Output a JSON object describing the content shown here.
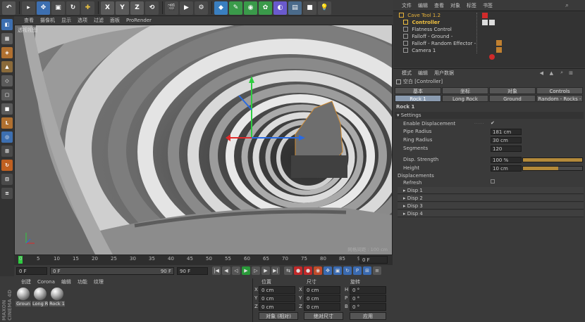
{
  "toolbar": {
    "axis_labels": [
      "X",
      "Y",
      "Z"
    ]
  },
  "viewport": {
    "menu": [
      "查看",
      "摄像机",
      "显示",
      "选项",
      "过滤",
      "面板",
      "ProRender"
    ],
    "view_name": "透视视图",
    "grid_info": "网格间距 : 100 cm"
  },
  "timeline": {
    "ticks": [
      "0",
      "5",
      "10",
      "15",
      "20",
      "25",
      "30",
      "35",
      "40",
      "45",
      "50",
      "55",
      "60",
      "65",
      "70",
      "75",
      "80",
      "85",
      "90"
    ],
    "current_frame": "0 F",
    "start": "0 F",
    "range_start": "0 F",
    "range_end": "90 F",
    "end": "90 F"
  },
  "materials": {
    "menu": [
      "创建",
      "Corona",
      "编辑",
      "功能",
      "纹理"
    ],
    "items": [
      "Groun",
      "Long R",
      "Rock 1"
    ],
    "brand": "MAXON CINEMA 4D"
  },
  "coordinates": {
    "headers": [
      "位置",
      "尺寸",
      "旋转"
    ],
    "rows": [
      {
        "axis": "X",
        "pos": "0 cm",
        "size_axis": "X",
        "size": "0 cm",
        "rot_axis": "H",
        "rot": "0 °"
      },
      {
        "axis": "Y",
        "pos": "0 cm",
        "size_axis": "Y",
        "size": "0 cm",
        "rot_axis": "P",
        "rot": "0 °"
      },
      {
        "axis": "Z",
        "pos": "0 cm",
        "size_axis": "Z",
        "size": "0 cm",
        "rot_axis": "B",
        "rot": "0 °"
      }
    ],
    "mode": "对象 (相对)",
    "size_mode": "绝对尺寸",
    "apply": "应用"
  },
  "objects": {
    "menu": [
      "文件",
      "编辑",
      "查看",
      "对象",
      "标签",
      "书签"
    ],
    "items": [
      {
        "name": "Cave Tool 1.2",
        "color": "#e8b33a"
      },
      {
        "name": "Controller",
        "color": "#f0c040"
      },
      {
        "name": "Flatness Control",
        "color": "#cfcfcf"
      },
      {
        "name": "Falloff - Ground -",
        "color": "#cfcfcf"
      },
      {
        "name": "Falloff - Random Effector -",
        "color": "#cfcfcf"
      },
      {
        "name": "Camera 1",
        "color": "#cfcfcf"
      }
    ]
  },
  "attributes": {
    "menu": [
      "模式",
      "编辑",
      "用户数据"
    ],
    "title": "空白 [Controller]",
    "tabs_row1": [
      "基本",
      "坐标",
      "对象",
      "Controls"
    ],
    "tabs_row2": [
      "Rock 1",
      "Long Rock",
      "Ground",
      "Random - Rocks -"
    ],
    "section": "Rock 1",
    "group": "Settings",
    "props": [
      {
        "label": "Enable Displacement",
        "value": "✔"
      },
      {
        "label": "Pipe Radius",
        "value": "181 cm"
      },
      {
        "label": "Ring Radius",
        "value": "30 cm"
      },
      {
        "label": "Segments",
        "value": "120"
      },
      {
        "label": "Disp. Strength",
        "value": "100 %",
        "level": 1.0
      },
      {
        "label": "Height",
        "value": "10 cm",
        "level": 0.6
      }
    ],
    "displacements_label": "Displacements",
    "refresh_label": "Refresh",
    "disp_groups": [
      "Disp 1",
      "Disp 2",
      "Disp 3",
      "Disp 4"
    ]
  }
}
